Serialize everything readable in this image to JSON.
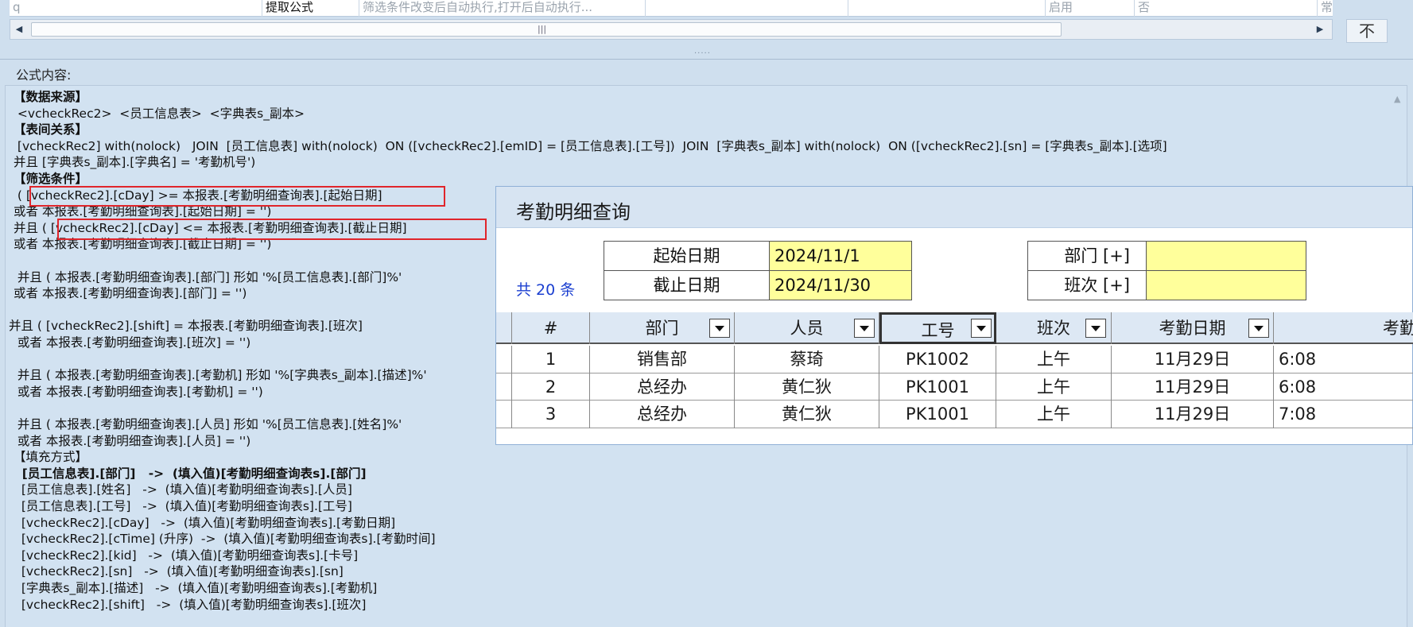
{
  "top_grid": {
    "row": {
      "col_q": "q",
      "col_name": "提取公式",
      "col_desc": "筛选条件改变后自动执行,打开后自动执行...",
      "col_status": "启用",
      "col_flag": "否",
      "col_type": "常规"
    },
    "scroll_grip": "|||",
    "corner_button": "不",
    "splitter": "....."
  },
  "formula": {
    "label": "公式内容:",
    "lines": [
      "【数据来源】",
      " <vcheckRec2>  <员工信息表>  <字典表s_副本>",
      "【表间关系】",
      " [vcheckRec2] with(nolock)   JOIN  [员工信息表] with(nolock)  ON ([vcheckRec2].[emID] = [员工信息表].[工号])  JOIN  [字典表s_副本] with(nolock)  ON ([vcheckRec2].[sn] = [字典表s_副本].[选项]",
      "并且 [字典表s_副本].[字典名] = '考勤机号')",
      "【筛选条件】",
      " ( [vcheckRec2].[cDay] >= 本报表.[考勤明细查询表].[起始日期]",
      "或者 本报表.[考勤明细查询表].[起始日期] = '')",
      "并且 ( [vcheckRec2].[cDay] <= 本报表.[考勤明细查询表].[截止日期]",
      "或者 本报表.[考勤明细查询表].[截止日期] = '')",
      "",
      " 并且 ( 本报表.[考勤明细查询表].[部门] 形如 '%[员工信息表].[部门]%'",
      "或者 本报表.[考勤明细查询表].[部门] = '')",
      "",
      "并且 ( [vcheckRec2].[shift] = 本报表.[考勤明细查询表].[班次]",
      " 或者 本报表.[考勤明细查询表].[班次] = '')",
      "",
      " 并且 ( 本报表.[考勤明细查询表].[考勤机] 形如 '%[字典表s_副本].[描述]%'",
      " 或者 本报表.[考勤明细查询表].[考勤机] = '')",
      "",
      " 并且 ( 本报表.[考勤明细查询表].[人员] 形如 '%[员工信息表].[姓名]%'",
      " 或者 本报表.[考勤明细查询表].[人员] = '')",
      "【填充方式】",
      "  [员工信息表].[部门]   ->  (填入值)[考勤明细查询表s].[部门]",
      "  [员工信息表].[姓名]   ->  (填入值)[考勤明细查询表s].[人员]",
      "  [员工信息表].[工号]   ->  (填入值)[考勤明细查询表s].[工号]",
      "  [vcheckRec2].[cDay]   ->  (填入值)[考勤明细查询表s].[考勤日期]",
      "  [vcheckRec2].[cTime] (升序)  ->  (填入值)[考勤明细查询表s].[考勤时间]",
      "  [vcheckRec2].[kid]   ->  (填入值)[考勤明细查询表s].[卡号]",
      "  [vcheckRec2].[sn]   ->  (填入值)[考勤明细查询表s].[sn]",
      "  [字典表s_副本].[描述]   ->  (填入值)[考勤明细查询表s].[考勤机]",
      "  [vcheckRec2].[shift]   ->  (填入值)[考勤明细查询表s].[班次]"
    ]
  },
  "dialog": {
    "title": "考勤明细查询",
    "count": "共 20 条",
    "start_label": "起始日期",
    "start_value": "2024/11/1",
    "end_label": "截止日期",
    "end_value": "2024/11/30",
    "dept_label": "部门 [+]",
    "dept_value": "",
    "shift_label": "班次 [+]",
    "shift_value": "",
    "columns": [
      "#",
      "部门",
      "人员",
      "工号",
      "班次",
      "考勤日期",
      "考勤时"
    ],
    "rows": [
      {
        "no": "1",
        "dept": "销售部",
        "person": "蔡琦",
        "id": "PK1002",
        "shift": "上午",
        "date": "11月29日",
        "time": "6:08"
      },
      {
        "no": "2",
        "dept": "总经办",
        "person": "黄仁狄",
        "id": "PK1001",
        "shift": "上午",
        "date": "11月29日",
        "time": "6:08"
      },
      {
        "no": "3",
        "dept": "总经办",
        "person": "黄仁狄",
        "id": "PK1001",
        "shift": "上午",
        "date": "11月29日",
        "time": "7:08"
      }
    ]
  },
  "colors": {
    "highlight": "#e0252b",
    "field_value_bg": "#ffff9b",
    "count_text": "#1b3fd0",
    "panel_bg": "#d2e2f1"
  }
}
